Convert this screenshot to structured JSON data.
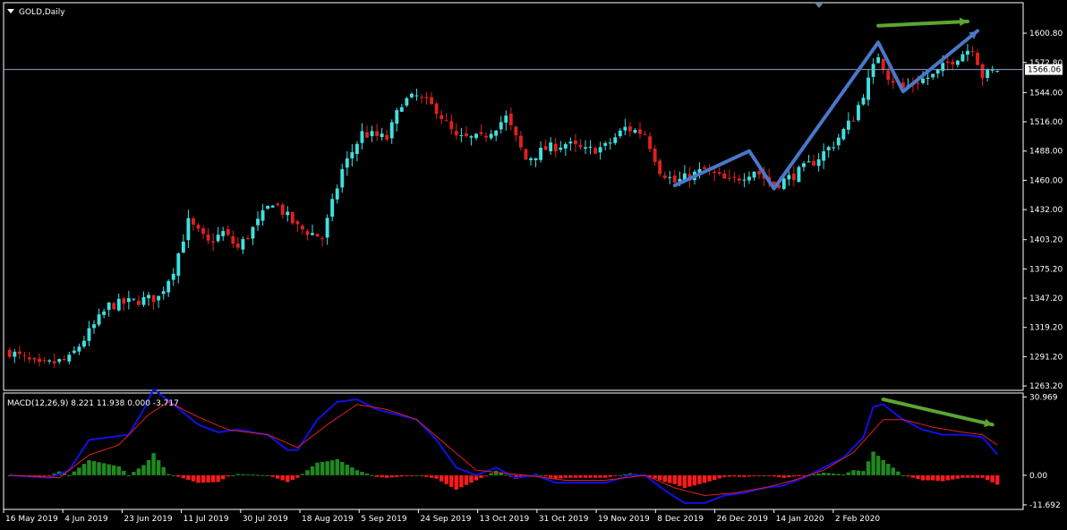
{
  "window": {
    "title": "GOLD,Daily",
    "menu_icon": "triangle-down-icon"
  },
  "colors": {
    "background": "#000000",
    "grid_frame": "#ffffff",
    "bull_candle": "#3fe0e0",
    "bear_candle": "#e02020",
    "price_line": "#8aa0c8",
    "macd_line": "#1010e8",
    "signal_line": "#e02020",
    "hist_positive": "#1f8a1f",
    "hist_negative": "#ff1a1a",
    "pattern_arrow": "#4a78c8",
    "divergence_arrow": "#5aa632",
    "tick_marker": "#6f7f9f"
  },
  "chart_data": [
    {
      "type": "candlestick",
      "title": "GOLD,Daily",
      "current_price_label": "1566.06",
      "current_price": 1566.06,
      "y_ticks": [
        "1600.80",
        "1572.80",
        "1544.00",
        "1516.00",
        "1488.00",
        "1460.00",
        "1432.00",
        "1403.20",
        "1375.20",
        "1347.20",
        "1319.20",
        "1291.20",
        "1263.20"
      ],
      "ylim": [
        1259,
        1630
      ],
      "x_ticks": [
        "16 May 2019",
        "4 Jun 2019",
        "23 Jun 2019",
        "11 Jul 2019",
        "30 Jul 2019",
        "18 Aug 2019",
        "5 Sep 2019",
        "24 Sep 2019",
        "13 Oct 2019",
        "31 Oct 2019",
        "19 Nov 2019",
        "8 Dec 2019",
        "26 Dec 2019",
        "14 Jan 2020",
        "2 Feb 2020"
      ],
      "bars_count": 200,
      "close_path": [
        {
          "bar": 0,
          "close": 1296
        },
        {
          "bar": 6,
          "close": 1282
        },
        {
          "bar": 12,
          "close": 1289
        },
        {
          "bar": 20,
          "close": 1340
        },
        {
          "bar": 26,
          "close": 1345
        },
        {
          "bar": 30,
          "close": 1348
        },
        {
          "bar": 33,
          "close": 1375
        },
        {
          "bar": 36,
          "close": 1420
        },
        {
          "bar": 40,
          "close": 1400
        },
        {
          "bar": 43,
          "close": 1410
        },
        {
          "bar": 46,
          "close": 1395
        },
        {
          "bar": 50,
          "close": 1420
        },
        {
          "bar": 53,
          "close": 1440
        },
        {
          "bar": 58,
          "close": 1415
        },
        {
          "bar": 63,
          "close": 1405
        },
        {
          "bar": 67,
          "close": 1470
        },
        {
          "bar": 71,
          "close": 1505
        },
        {
          "bar": 76,
          "close": 1500
        },
        {
          "bar": 79,
          "close": 1535
        },
        {
          "bar": 82,
          "close": 1540
        },
        {
          "bar": 86,
          "close": 1528
        },
        {
          "bar": 90,
          "close": 1500
        },
        {
          "bar": 95,
          "close": 1500
        },
        {
          "bar": 100,
          "close": 1520
        },
        {
          "bar": 104,
          "close": 1480
        },
        {
          "bar": 108,
          "close": 1490
        },
        {
          "bar": 112,
          "close": 1495
        },
        {
          "bar": 116,
          "close": 1488
        },
        {
          "bar": 120,
          "close": 1492
        },
        {
          "bar": 124,
          "close": 1510
        },
        {
          "bar": 128,
          "close": 1505
        },
        {
          "bar": 131,
          "close": 1470
        },
        {
          "bar": 134,
          "close": 1458
        },
        {
          "bar": 140,
          "close": 1470
        },
        {
          "bar": 145,
          "close": 1458
        },
        {
          "bar": 150,
          "close": 1470
        },
        {
          "bar": 154,
          "close": 1455
        },
        {
          "bar": 158,
          "close": 1465
        },
        {
          "bar": 162,
          "close": 1478
        },
        {
          "bar": 166,
          "close": 1495
        },
        {
          "bar": 170,
          "close": 1520
        },
        {
          "bar": 173,
          "close": 1555
        },
        {
          "bar": 175,
          "close": 1580
        },
        {
          "bar": 177,
          "close": 1560
        },
        {
          "bar": 180,
          "close": 1548
        },
        {
          "bar": 183,
          "close": 1555
        },
        {
          "bar": 186,
          "close": 1560
        },
        {
          "bar": 189,
          "close": 1572
        },
        {
          "bar": 192,
          "close": 1582
        },
        {
          "bar": 194,
          "close": 1588
        },
        {
          "bar": 196,
          "close": 1560
        },
        {
          "bar": 199,
          "close": 1566
        }
      ],
      "annotations": [
        {
          "name": "w-pattern-arrow",
          "points": [
            {
              "bar": 134,
              "price": 1455
            },
            {
              "bar": 149,
              "price": 1488
            },
            {
              "bar": 154,
              "price": 1452
            },
            {
              "bar": 175,
              "price": 1592
            },
            {
              "bar": 180,
              "price": 1545
            },
            {
              "bar": 195,
              "price": 1603
            }
          ]
        },
        {
          "name": "price-divergence-arrow",
          "points": [
            {
              "bar": 175,
              "price": 1608
            },
            {
              "bar": 193,
              "price": 1612
            }
          ]
        }
      ]
    },
    {
      "type": "macd",
      "label": "MACD(12,26,9) 8.221 11.938 0.000 -3.717",
      "y_ticks": [
        "30.969",
        "0.00",
        "-11.692"
      ],
      "ylim": [
        -13.5,
        32.5
      ],
      "macd_path": [
        {
          "bar": 0,
          "value": 0
        },
        {
          "bar": 8,
          "value": -1
        },
        {
          "bar": 12,
          "value": 2
        },
        {
          "bar": 16,
          "value": 14
        },
        {
          "bar": 20,
          "value": 15
        },
        {
          "bar": 24,
          "value": 16
        },
        {
          "bar": 27,
          "value": 26
        },
        {
          "bar": 29,
          "value": 34
        },
        {
          "bar": 33,
          "value": 28
        },
        {
          "bar": 38,
          "value": 20
        },
        {
          "bar": 42,
          "value": 17
        },
        {
          "bar": 46,
          "value": 18
        },
        {
          "bar": 52,
          "value": 16
        },
        {
          "bar": 56,
          "value": 10
        },
        {
          "bar": 58,
          "value": 10
        },
        {
          "bar": 62,
          "value": 22
        },
        {
          "bar": 66,
          "value": 29
        },
        {
          "bar": 70,
          "value": 30
        },
        {
          "bar": 74,
          "value": 26
        },
        {
          "bar": 78,
          "value": 24
        },
        {
          "bar": 82,
          "value": 22
        },
        {
          "bar": 86,
          "value": 14
        },
        {
          "bar": 90,
          "value": 3
        },
        {
          "bar": 94,
          "value": 0
        },
        {
          "bar": 98,
          "value": 3
        },
        {
          "bar": 102,
          "value": -1
        },
        {
          "bar": 106,
          "value": 0
        },
        {
          "bar": 110,
          "value": -3
        },
        {
          "bar": 116,
          "value": -3
        },
        {
          "bar": 120,
          "value": -3
        },
        {
          "bar": 125,
          "value": 0
        },
        {
          "bar": 128,
          "value": 0
        },
        {
          "bar": 132,
          "value": -6
        },
        {
          "bar": 136,
          "value": -11
        },
        {
          "bar": 140,
          "value": -11
        },
        {
          "bar": 144,
          "value": -8
        },
        {
          "bar": 148,
          "value": -7
        },
        {
          "bar": 152,
          "value": -5
        },
        {
          "bar": 156,
          "value": -4
        },
        {
          "bar": 160,
          "value": -1
        },
        {
          "bar": 164,
          "value": 3
        },
        {
          "bar": 168,
          "value": 7
        },
        {
          "bar": 172,
          "value": 15
        },
        {
          "bar": 174,
          "value": 27
        },
        {
          "bar": 176,
          "value": 28
        },
        {
          "bar": 180,
          "value": 22
        },
        {
          "bar": 184,
          "value": 18
        },
        {
          "bar": 188,
          "value": 16
        },
        {
          "bar": 192,
          "value": 16
        },
        {
          "bar": 196,
          "value": 15
        },
        {
          "bar": 199,
          "value": 8.221
        }
      ],
      "signal_path": [
        {
          "bar": 0,
          "value": 0
        },
        {
          "bar": 10,
          "value": -1
        },
        {
          "bar": 16,
          "value": 8
        },
        {
          "bar": 22,
          "value": 12
        },
        {
          "bar": 28,
          "value": 24
        },
        {
          "bar": 32,
          "value": 29
        },
        {
          "bar": 38,
          "value": 23
        },
        {
          "bar": 44,
          "value": 18
        },
        {
          "bar": 52,
          "value": 16
        },
        {
          "bar": 58,
          "value": 11
        },
        {
          "bar": 64,
          "value": 20
        },
        {
          "bar": 70,
          "value": 28
        },
        {
          "bar": 76,
          "value": 26
        },
        {
          "bar": 82,
          "value": 22
        },
        {
          "bar": 88,
          "value": 12
        },
        {
          "bar": 94,
          "value": 2
        },
        {
          "bar": 104,
          "value": 0
        },
        {
          "bar": 112,
          "value": -2
        },
        {
          "bar": 120,
          "value": -2
        },
        {
          "bar": 128,
          "value": 0
        },
        {
          "bar": 134,
          "value": -5
        },
        {
          "bar": 140,
          "value": -8
        },
        {
          "bar": 146,
          "value": -7
        },
        {
          "bar": 152,
          "value": -5
        },
        {
          "bar": 158,
          "value": -2
        },
        {
          "bar": 164,
          "value": 2
        },
        {
          "bar": 170,
          "value": 9
        },
        {
          "bar": 176,
          "value": 22
        },
        {
          "bar": 180,
          "value": 22
        },
        {
          "bar": 186,
          "value": 19
        },
        {
          "bar": 192,
          "value": 17
        },
        {
          "bar": 196,
          "value": 16
        },
        {
          "bar": 199,
          "value": 11.938
        }
      ],
      "annotations": [
        {
          "name": "macd-divergence-arrow",
          "points": [
            {
              "bar": 176,
              "value": 30
            },
            {
              "bar": 198,
              "value": 20
            }
          ]
        }
      ]
    }
  ]
}
